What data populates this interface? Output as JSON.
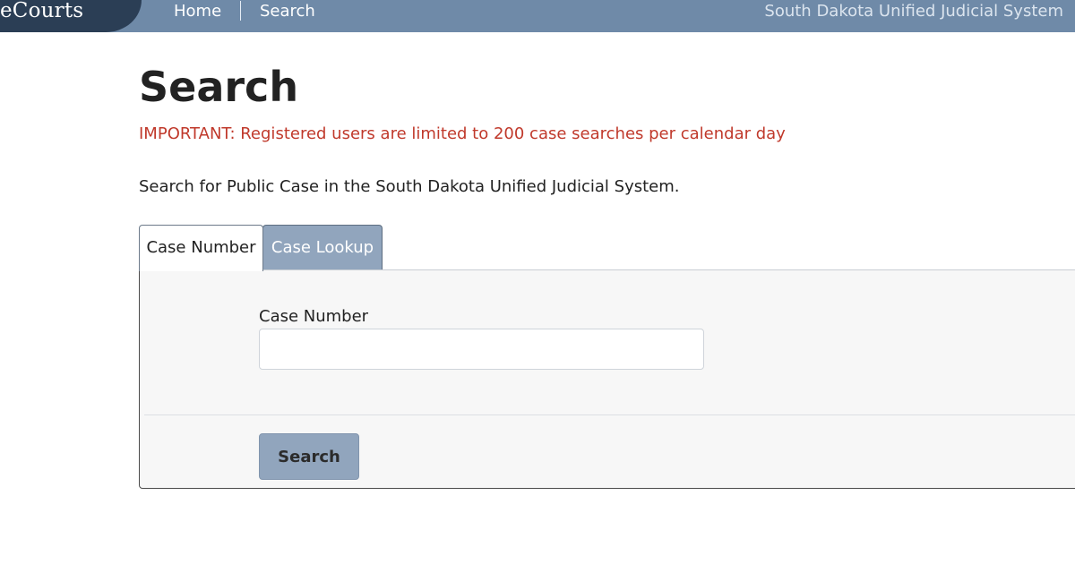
{
  "header": {
    "brand": "eCourts",
    "nav": {
      "home": "Home",
      "search": "Search"
    },
    "system_name": "South Dakota Unified Judicial System"
  },
  "main": {
    "title": "Search",
    "important_notice": "IMPORTANT: Registered users are limited to 200 case searches per calendar day",
    "intro": "Search for Public Case in the South Dakota Unified Judicial System.",
    "tabs": [
      {
        "label": "Case Number",
        "active": true
      },
      {
        "label": "Case Lookup",
        "active": false
      }
    ],
    "form": {
      "case_number_label": "Case Number",
      "case_number_value": "",
      "submit_label": "Search"
    }
  },
  "colors": {
    "header_bg": "#6f8aa8",
    "brand_bg": "#2b3e55",
    "notice": "#c0392b",
    "accent_button": "#91a5bd"
  }
}
